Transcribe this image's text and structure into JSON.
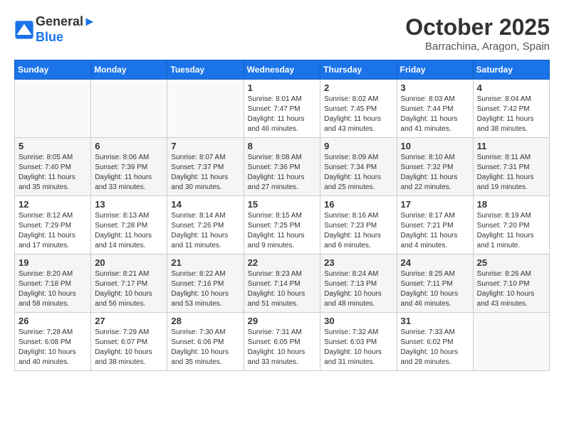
{
  "header": {
    "logo_line1": "General",
    "logo_line2": "Blue",
    "month": "October 2025",
    "location": "Barrachina, Aragon, Spain"
  },
  "days_of_week": [
    "Sunday",
    "Monday",
    "Tuesday",
    "Wednesday",
    "Thursday",
    "Friday",
    "Saturday"
  ],
  "weeks": [
    [
      {
        "num": "",
        "info": ""
      },
      {
        "num": "",
        "info": ""
      },
      {
        "num": "",
        "info": ""
      },
      {
        "num": "1",
        "info": "Sunrise: 8:01 AM\nSunset: 7:47 PM\nDaylight: 11 hours and 46 minutes."
      },
      {
        "num": "2",
        "info": "Sunrise: 8:02 AM\nSunset: 7:45 PM\nDaylight: 11 hours and 43 minutes."
      },
      {
        "num": "3",
        "info": "Sunrise: 8:03 AM\nSunset: 7:44 PM\nDaylight: 11 hours and 41 minutes."
      },
      {
        "num": "4",
        "info": "Sunrise: 8:04 AM\nSunset: 7:42 PM\nDaylight: 11 hours and 38 minutes."
      }
    ],
    [
      {
        "num": "5",
        "info": "Sunrise: 8:05 AM\nSunset: 7:40 PM\nDaylight: 11 hours and 35 minutes."
      },
      {
        "num": "6",
        "info": "Sunrise: 8:06 AM\nSunset: 7:39 PM\nDaylight: 11 hours and 33 minutes."
      },
      {
        "num": "7",
        "info": "Sunrise: 8:07 AM\nSunset: 7:37 PM\nDaylight: 11 hours and 30 minutes."
      },
      {
        "num": "8",
        "info": "Sunrise: 8:08 AM\nSunset: 7:36 PM\nDaylight: 11 hours and 27 minutes."
      },
      {
        "num": "9",
        "info": "Sunrise: 8:09 AM\nSunset: 7:34 PM\nDaylight: 11 hours and 25 minutes."
      },
      {
        "num": "10",
        "info": "Sunrise: 8:10 AM\nSunset: 7:32 PM\nDaylight: 11 hours and 22 minutes."
      },
      {
        "num": "11",
        "info": "Sunrise: 8:11 AM\nSunset: 7:31 PM\nDaylight: 11 hours and 19 minutes."
      }
    ],
    [
      {
        "num": "12",
        "info": "Sunrise: 8:12 AM\nSunset: 7:29 PM\nDaylight: 11 hours and 17 minutes."
      },
      {
        "num": "13",
        "info": "Sunrise: 8:13 AM\nSunset: 7:28 PM\nDaylight: 11 hours and 14 minutes."
      },
      {
        "num": "14",
        "info": "Sunrise: 8:14 AM\nSunset: 7:26 PM\nDaylight: 11 hours and 11 minutes."
      },
      {
        "num": "15",
        "info": "Sunrise: 8:15 AM\nSunset: 7:25 PM\nDaylight: 11 hours and 9 minutes."
      },
      {
        "num": "16",
        "info": "Sunrise: 8:16 AM\nSunset: 7:23 PM\nDaylight: 11 hours and 6 minutes."
      },
      {
        "num": "17",
        "info": "Sunrise: 8:17 AM\nSunset: 7:21 PM\nDaylight: 11 hours and 4 minutes."
      },
      {
        "num": "18",
        "info": "Sunrise: 8:19 AM\nSunset: 7:20 PM\nDaylight: 11 hours and 1 minute."
      }
    ],
    [
      {
        "num": "19",
        "info": "Sunrise: 8:20 AM\nSunset: 7:18 PM\nDaylight: 10 hours and 58 minutes."
      },
      {
        "num": "20",
        "info": "Sunrise: 8:21 AM\nSunset: 7:17 PM\nDaylight: 10 hours and 56 minutes."
      },
      {
        "num": "21",
        "info": "Sunrise: 8:22 AM\nSunset: 7:16 PM\nDaylight: 10 hours and 53 minutes."
      },
      {
        "num": "22",
        "info": "Sunrise: 8:23 AM\nSunset: 7:14 PM\nDaylight: 10 hours and 51 minutes."
      },
      {
        "num": "23",
        "info": "Sunrise: 8:24 AM\nSunset: 7:13 PM\nDaylight: 10 hours and 48 minutes."
      },
      {
        "num": "24",
        "info": "Sunrise: 8:25 AM\nSunset: 7:11 PM\nDaylight: 10 hours and 46 minutes."
      },
      {
        "num": "25",
        "info": "Sunrise: 8:26 AM\nSunset: 7:10 PM\nDaylight: 10 hours and 43 minutes."
      }
    ],
    [
      {
        "num": "26",
        "info": "Sunrise: 7:28 AM\nSunset: 6:08 PM\nDaylight: 10 hours and 40 minutes."
      },
      {
        "num": "27",
        "info": "Sunrise: 7:29 AM\nSunset: 6:07 PM\nDaylight: 10 hours and 38 minutes."
      },
      {
        "num": "28",
        "info": "Sunrise: 7:30 AM\nSunset: 6:06 PM\nDaylight: 10 hours and 35 minutes."
      },
      {
        "num": "29",
        "info": "Sunrise: 7:31 AM\nSunset: 6:05 PM\nDaylight: 10 hours and 33 minutes."
      },
      {
        "num": "30",
        "info": "Sunrise: 7:32 AM\nSunset: 6:03 PM\nDaylight: 10 hours and 31 minutes."
      },
      {
        "num": "31",
        "info": "Sunrise: 7:33 AM\nSunset: 6:02 PM\nDaylight: 10 hours and 28 minutes."
      },
      {
        "num": "",
        "info": ""
      }
    ]
  ]
}
